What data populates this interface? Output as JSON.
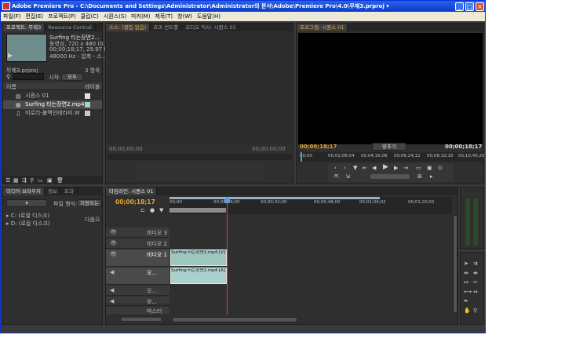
{
  "window": {
    "title": "Adobe Premiere Pro - C:\\Documents and Settings\\Administrator\\Administrator의 문서\\Adobe\\Premiere Pro\\4.0\\무제3.prproj ▾",
    "minimize": "_",
    "maximize": "□",
    "close": "×"
  },
  "menu": [
    "파일(F)",
    "편집(E)",
    "프로젝트(P)",
    "클립(C)",
    "시퀀스(S)",
    "마커(M)",
    "제목(T)",
    "창(W)",
    "도움말(H)"
  ],
  "project": {
    "tabs": [
      "프로젝트: 무제3",
      "Resource Central"
    ],
    "clip_name": "Surfing 타는장면2...",
    "clip_info1": "동영상, 720 x 480 (0...",
    "clip_info2": "00;00;18;17, 29.97 fps",
    "clip_info3": "48000 Hz - 압축 - 스...",
    "project_file": "무제3.prproj",
    "item_count": "3 항목",
    "search_label": "시작:",
    "search_value": "모두",
    "col_name": "이름",
    "col_label": "레이블",
    "items": [
      "시퀀스 01",
      "Surfing 타는장면2.mp4",
      "미로리-불멕인테라피.W"
    ],
    "bottom_bin": "Bin"
  },
  "source": {
    "tabs": [
      "소스: (클립 없음)",
      "효과 컨트롤",
      "오디오 믹서: 시퀀스 01"
    ],
    "tc_left": "00;00;00;00",
    "tc_right": "00;00;00;00"
  },
  "program": {
    "tab": "프로그램: 시퀀스 01",
    "tc_current": "00;00;18;17",
    "fit": "맞추기",
    "tc_duration": "00;00;18;17",
    "ruler": [
      "00;00",
      "00;02;08;04",
      "00;04;16;08",
      "00;06;24;12",
      "00;08;32;16",
      "00;10;40;20"
    ]
  },
  "media": {
    "tabs": [
      "미디어 브라우저",
      "정보",
      "효과"
    ],
    "file_type_label": "파일 형식:",
    "file_type_value": "지원되는 ...",
    "drives": [
      "C: (로컬 디스크)",
      "D: (로컬 디스크)"
    ],
    "next_label": "다음으"
  },
  "timeline": {
    "tab": "타임라인: 시퀀스 01",
    "tc": "00;00;18;17",
    "ruler": [
      "00;00",
      "00;00;16;00",
      "00;00;32;00",
      "00;00;48;00",
      "00;01;04;02",
      "00;01;20;02"
    ],
    "tracks": [
      {
        "name": "비디오 3"
      },
      {
        "name": "비디오 2"
      },
      {
        "name": "비디오 1"
      },
      {
        "name": "오..."
      },
      {
        "name": "오..."
      },
      {
        "name": "오..."
      },
      {
        "name": "오..."
      },
      {
        "name": "마스터"
      }
    ],
    "video_clip": "Surfing 타는장면2.mp4 [V]",
    "audio_clip": "Surfing 타는장면2.mp4 [A]"
  },
  "colors": {
    "accent": "#e8a135",
    "panel": "#2f2f2f",
    "clip": "#9fc7c0",
    "titlebar": "#0a3bc7"
  }
}
